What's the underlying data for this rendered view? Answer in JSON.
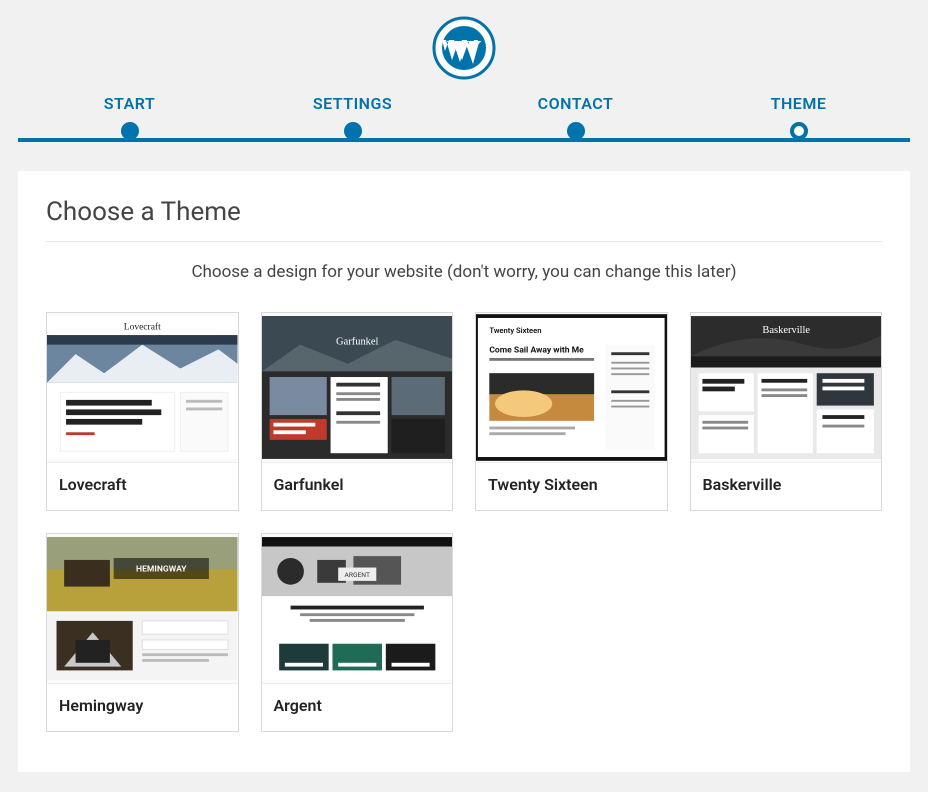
{
  "brand": {
    "color": "#0073aa"
  },
  "steps": {
    "items": [
      {
        "label": "START"
      },
      {
        "label": "SETTINGS"
      },
      {
        "label": "CONTACT"
      },
      {
        "label": "THEME"
      }
    ],
    "current_index": 3
  },
  "page": {
    "title": "Choose a Theme",
    "subtitle": "Choose a design for your website (don't worry, you can change this later)"
  },
  "themes": [
    {
      "name": "Lovecraft",
      "slug": "lovecraft"
    },
    {
      "name": "Garfunkel",
      "slug": "garfunkel"
    },
    {
      "name": "Twenty Sixteen",
      "slug": "twentysixteen"
    },
    {
      "name": "Baskerville",
      "slug": "baskerville"
    },
    {
      "name": "Hemingway",
      "slug": "hemingway"
    },
    {
      "name": "Argent",
      "slug": "argent"
    }
  ]
}
